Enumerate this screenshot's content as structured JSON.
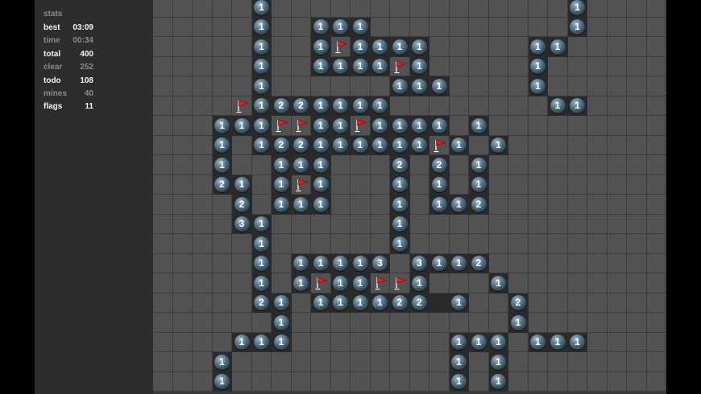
{
  "stats": {
    "header": "stats",
    "rows": [
      {
        "key": "best",
        "value": "03:09",
        "style": "hi"
      },
      {
        "key": "time",
        "value": "00:34",
        "style": "lo"
      },
      {
        "key": "total",
        "value": "400",
        "style": "hi"
      },
      {
        "key": "clear",
        "value": "252",
        "style": "lo"
      },
      {
        "key": "todo",
        "value": "108",
        "style": "hi"
      },
      {
        "key": "mines",
        "value": "40",
        "style": "lo"
      },
      {
        "key": "flags",
        "value": "11",
        "style": "hi"
      }
    ]
  },
  "board": {
    "cols": 26,
    "rows": 20,
    "legend": {
      "covered": "#",
      "open": ".",
      "flag": "F",
      "digits": "1-8"
    },
    "cells": [
      "#####1###############1####",
      "#####1##111##########1####",
      "#####1##1F1111#####11#####",
      "#####1##1111F1#####1######",
      "#####1######111####1######",
      "####F1221111########11####",
      "###111FF11F1111#1#########",
      "###1#122111111F1#1########",
      "###1##111###2#2#1#########",
      "###21#1F1###1#1#1#########",
      "####2#111###1#112#########",
      "####31######1#############",
      "#####1######1#############",
      "#####1#11113#3112#########",
      "#####1#1F11FF1###1########",
      "#####21#111122.1##2#######",
      "######1###########1#######",
      "####111########111#111####",
      "###1###########1#1########",
      "###1###########1#1########"
    ]
  },
  "colors": {
    "covered": "#525252",
    "open": "#2a2a2a",
    "flag": "#e02020"
  }
}
